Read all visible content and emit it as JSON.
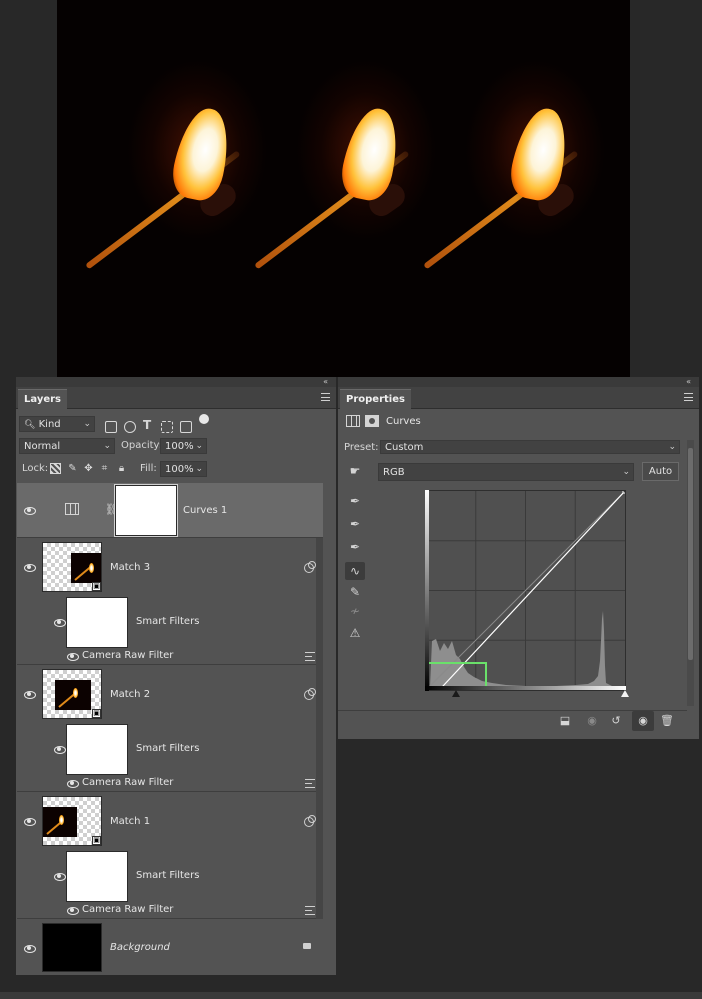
{
  "canvas": {
    "matches": [
      "match-left",
      "match-middle",
      "match-right"
    ]
  },
  "layers_panel": {
    "tab_label": "Layers",
    "filter_kind": "Kind",
    "blend_mode": "Normal",
    "opacity_label": "Opacity:",
    "opacity_value": "100%",
    "lock_label": "Lock:",
    "fill_label": "Fill:",
    "fill_value": "100%",
    "layers": [
      {
        "name": "Curves 1",
        "type": "adjustment",
        "selected": true
      },
      {
        "name": "Match 3",
        "type": "smart-object",
        "smart_filters_label": "Smart Filters",
        "filter_name": "Camera Raw Filter"
      },
      {
        "name": "Match 2",
        "type": "smart-object",
        "smart_filters_label": "Smart Filters",
        "filter_name": "Camera Raw Filter"
      },
      {
        "name": "Match 1",
        "type": "smart-object",
        "smart_filters_label": "Smart Filters",
        "filter_name": "Camera Raw Filter"
      },
      {
        "name": "Background",
        "type": "background",
        "locked": true
      }
    ]
  },
  "properties_panel": {
    "tab_label": "Properties",
    "adjustment_title": "Curves",
    "preset_label": "Preset:",
    "preset_value": "Custom",
    "channel_value": "RGB",
    "auto_label": "Auto",
    "curve": {
      "input_output_range": [
        0,
        255
      ],
      "points": [
        [
          0,
          0
        ],
        [
          17,
          0
        ],
        [
          255,
          255
        ]
      ],
      "highlight_color": "#6ae06a"
    },
    "histogram": {
      "color": "#8e8e8e"
    }
  },
  "colors": {
    "panel_bg": "#535353",
    "selected_row": "#6a6a6a",
    "app_bg": "#282828"
  }
}
